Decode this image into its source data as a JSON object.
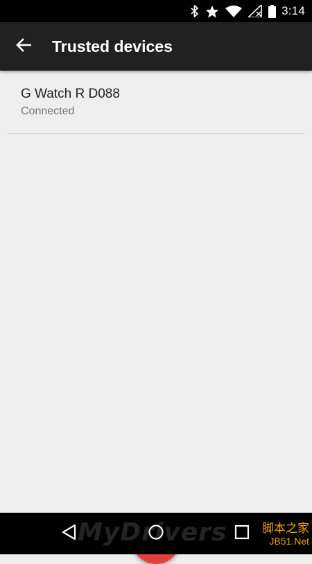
{
  "status_bar": {
    "time": "3:14",
    "icons": [
      "bluetooth-icon",
      "star-icon",
      "wifi-icon",
      "signal-icon",
      "battery-icon"
    ]
  },
  "toolbar": {
    "back_icon": "arrow-back-icon",
    "title": "Trusted devices"
  },
  "devices": [
    {
      "name": "G Watch R D088",
      "status": "Connected"
    }
  ],
  "fab": {
    "icon": "plus-icon",
    "color": "#e0413a"
  },
  "nav_bar": {
    "icons": [
      "back-triangle-icon",
      "home-circle-icon",
      "recents-square-icon"
    ]
  },
  "watermark": {
    "text": "MyDrivers",
    "corner_line1": "脚本之家",
    "corner_line2": "JB51.Net"
  },
  "colors": {
    "toolbar": "#212121",
    "background": "#eeeeee",
    "status_bar": "#000000",
    "nav_bar": "#000000"
  }
}
